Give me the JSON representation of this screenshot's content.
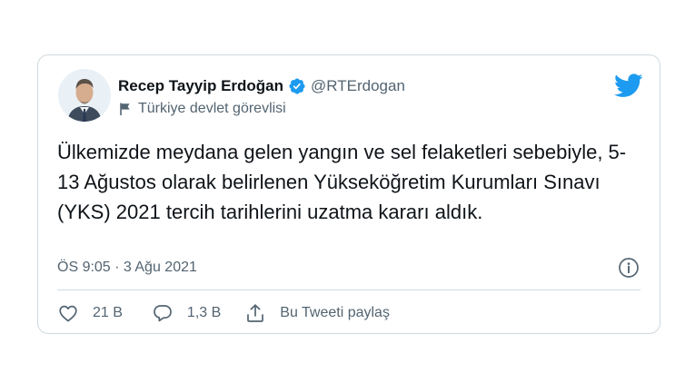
{
  "tweet": {
    "author": {
      "display_name": "Recep Tayyip Erdoğan",
      "handle": "@RTErdogan",
      "verified": true,
      "affiliation": "Türkiye devlet görevlisi",
      "avatar_icon": "avatar-photo"
    },
    "text": "Ülkemizde meydana gelen yangın ve sel felaketleri sebebiyle, 5-13 Ağustos olarak belirlenen Yükseköğretim Kurumları Sınavı (YKS) 2021 tercih tarihlerini uzatma kararı aldık.",
    "timestamp": "ÖS 9:05 · 3 Ağu 2021",
    "actions": {
      "likes": "21 B",
      "replies": "1,3 B",
      "share": "Bu Tweeti paylaş"
    }
  },
  "icons": {
    "verified": "verified-badge-icon",
    "flag": "flag-icon",
    "brand": "twitter-bird-icon",
    "info": "info-icon",
    "like": "heart-icon",
    "reply": "reply-bubble-icon",
    "share": "share-icon"
  },
  "colors": {
    "brand_blue": "#1d9bf0",
    "secondary_text": "#536471",
    "primary_text": "#0f1419",
    "border": "#cfd9de"
  }
}
